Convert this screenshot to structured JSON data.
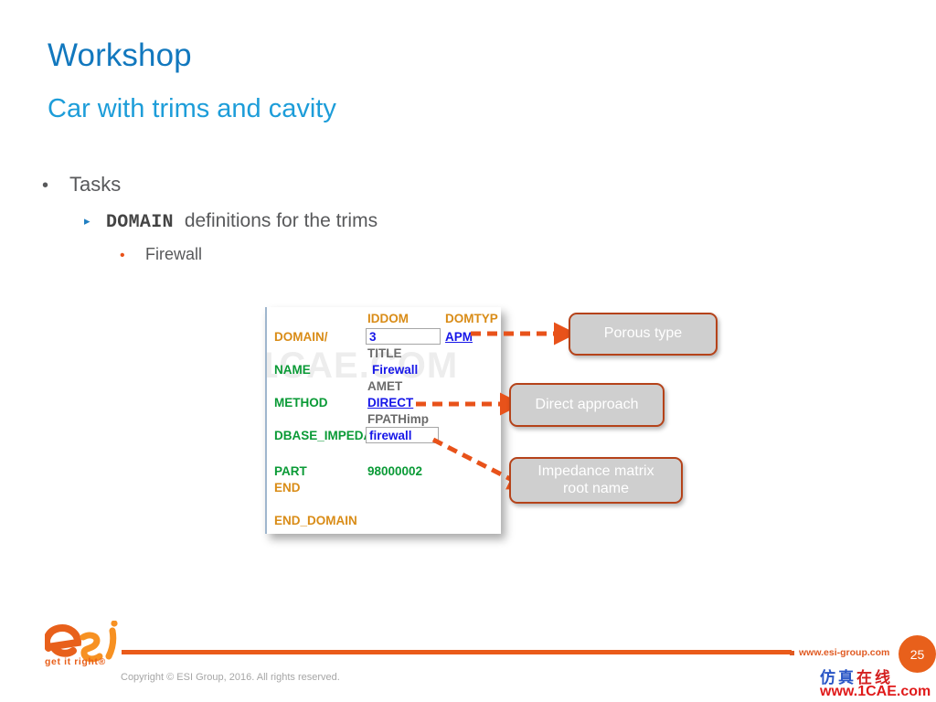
{
  "slide": {
    "title": "Workshop",
    "subtitle": "Car with trims and cavity"
  },
  "bullets": {
    "level1": "Tasks",
    "level2_code": "DOMAIN",
    "level2_rest": "definitions for the trims",
    "level3": "Firewall",
    "marker_l1": "•",
    "marker_l2": "▸",
    "marker_l3": "•"
  },
  "code_panel": {
    "watermark": "1CAE.COM",
    "rows": [
      {
        "label": "",
        "header": "IDDOM",
        "header2": "DOMTYP"
      },
      {
        "label": "DOMAIN/",
        "value": "3",
        "value2": "APM"
      },
      {
        "label": "",
        "header": "TITLE"
      },
      {
        "label": "NAME",
        "value": "Firewall"
      },
      {
        "label": "",
        "header": "AMET"
      },
      {
        "label": "METHOD",
        "value": "DIRECT"
      },
      {
        "label": "",
        "header": "FPATHimp"
      },
      {
        "label": "DBASE_IMPEDA",
        "value": "firewall"
      },
      {
        "label": "PART",
        "value": "98000002"
      },
      {
        "label": "END"
      },
      {
        "label": "END_DOMAIN"
      }
    ],
    "labels": {
      "domain": "DOMAIN/",
      "name": "NAME",
      "method": "METHOD",
      "dbase_imped": "DBASE_IMPEDA",
      "part": "PART",
      "end": "END",
      "end_domain": "END_DOMAIN"
    },
    "headers": {
      "iddom": "IDDOM",
      "domtyp": "DOMTYP",
      "title": "TITLE",
      "amet": "AMET",
      "fpathimp": "FPATHimp"
    },
    "values": {
      "iddom": "3",
      "domtyp": "APM",
      "title": "Firewall",
      "amet": "DIRECT",
      "fpathimp": "firewall",
      "part": "98000002"
    }
  },
  "callouts": {
    "porous": "Porous type",
    "direct": "Direct approach",
    "impedance_line1": "Impedance matrix",
    "impedance_line2": "root name"
  },
  "footer": {
    "copyright": "Copyright © ESI Group, 2016. All rights reserved.",
    "esi_url": "www.esi-group.com",
    "page_number": "25",
    "logo_tagline": "get it right®",
    "watermark_cn": "仿真在线",
    "watermark_url": "www.1CAE.com"
  },
  "colors": {
    "title_blue": "#1278be",
    "subtitle_blue": "#1d9dd9",
    "accent_orange": "#ea5b1a",
    "callout_border": "#b5431a",
    "callout_fill": "#cfcfcf",
    "code_orange": "#d98c17",
    "code_green": "#0a9a36",
    "code_blue": "#1616e8",
    "body_gray": "#58595b"
  }
}
